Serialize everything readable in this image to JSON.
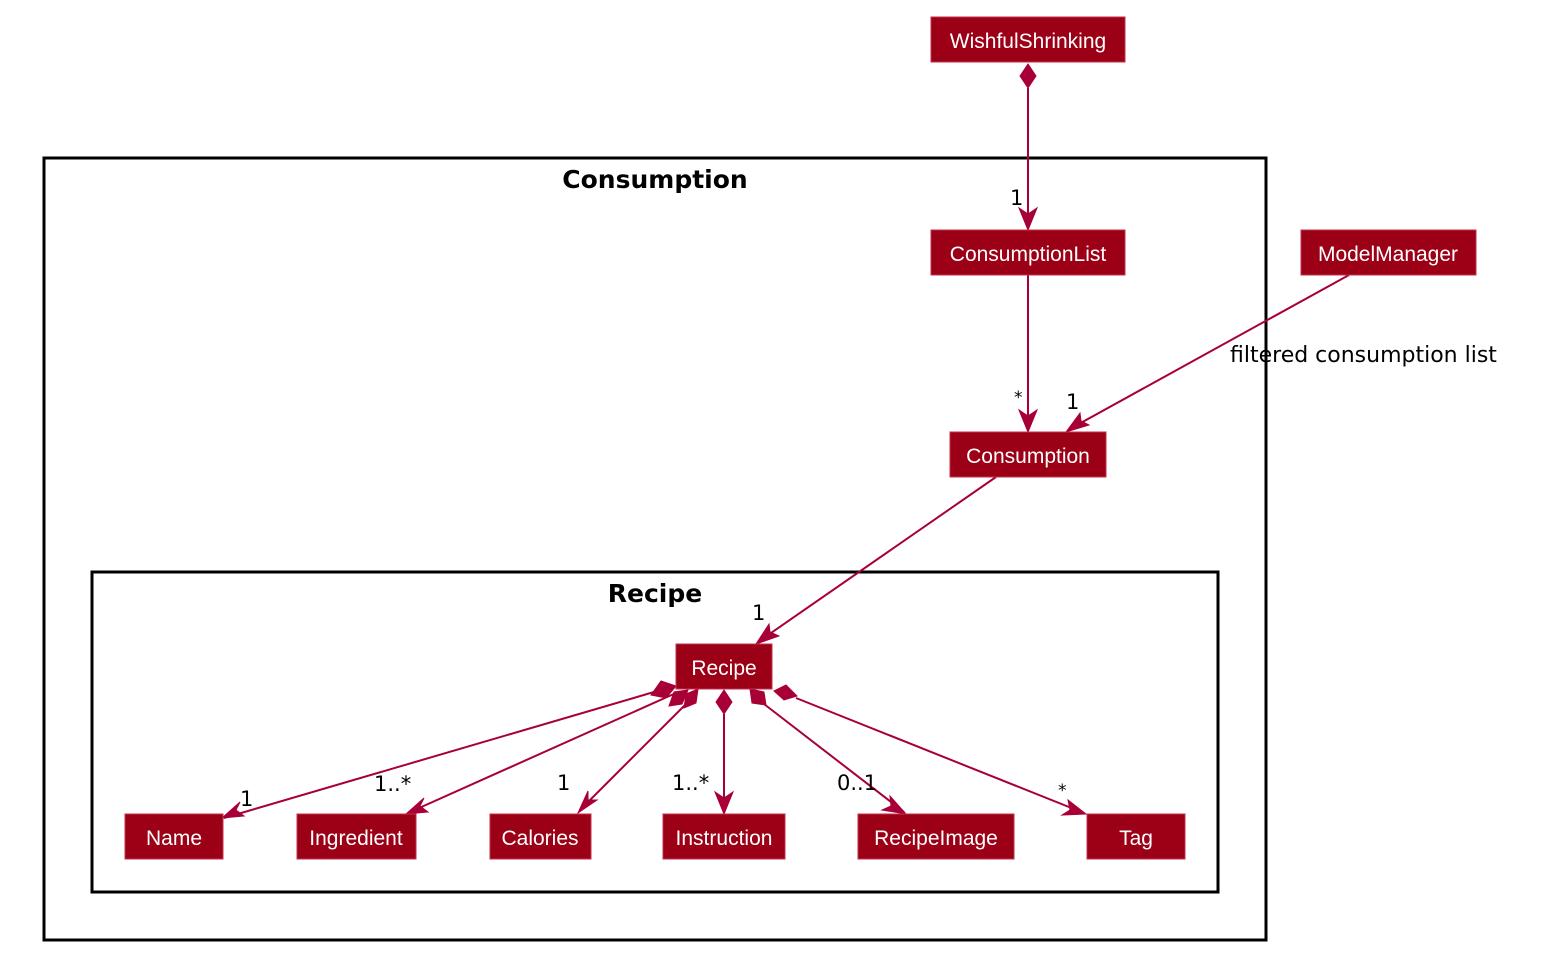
{
  "diagram": {
    "type": "uml-class-diagram",
    "colors": {
      "class_fill": "#9b0016",
      "edge": "#a80036",
      "class_text": "#ffffff",
      "package_border": "#000000"
    },
    "packages": [
      {
        "id": "consumption-pkg",
        "title": "Consumption"
      },
      {
        "id": "recipe-pkg",
        "title": "Recipe"
      }
    ],
    "classes": [
      {
        "id": "WishfulShrinking",
        "label": "WishfulShrinking"
      },
      {
        "id": "ConsumptionList",
        "label": "ConsumptionList"
      },
      {
        "id": "ModelManager",
        "label": "ModelManager"
      },
      {
        "id": "Consumption",
        "label": "Consumption"
      },
      {
        "id": "Recipe",
        "label": "Recipe"
      },
      {
        "id": "Name",
        "label": "Name"
      },
      {
        "id": "Ingredient",
        "label": "Ingredient"
      },
      {
        "id": "Calories",
        "label": "Calories"
      },
      {
        "id": "Instruction",
        "label": "Instruction"
      },
      {
        "id": "RecipeImage",
        "label": "RecipeImage"
      },
      {
        "id": "Tag",
        "label": "Tag"
      }
    ],
    "relations": [
      {
        "id": "ws-cl",
        "from": "WishfulShrinking",
        "to": "ConsumptionList",
        "kind": "composition",
        "multiplicity": "1",
        "label": ""
      },
      {
        "id": "cl-c",
        "from": "ConsumptionList",
        "to": "Consumption",
        "kind": "association",
        "multiplicity": "*",
        "label": ""
      },
      {
        "id": "mm-c",
        "from": "ModelManager",
        "to": "Consumption",
        "kind": "association",
        "multiplicity": "1",
        "label": "filtered consumption list"
      },
      {
        "id": "c-r",
        "from": "Consumption",
        "to": "Recipe",
        "kind": "association",
        "multiplicity": "1",
        "label": ""
      },
      {
        "id": "r-name",
        "from": "Recipe",
        "to": "Name",
        "kind": "composition",
        "multiplicity": "1",
        "label": ""
      },
      {
        "id": "r-ing",
        "from": "Recipe",
        "to": "Ingredient",
        "kind": "composition",
        "multiplicity": "1..*",
        "label": ""
      },
      {
        "id": "r-cal",
        "from": "Recipe",
        "to": "Calories",
        "kind": "composition",
        "multiplicity": "1",
        "label": ""
      },
      {
        "id": "r-ins",
        "from": "Recipe",
        "to": "Instruction",
        "kind": "composition",
        "multiplicity": "1..*",
        "label": ""
      },
      {
        "id": "r-img",
        "from": "Recipe",
        "to": "RecipeImage",
        "kind": "composition",
        "multiplicity": "0..1",
        "label": ""
      },
      {
        "id": "r-tag",
        "from": "Recipe",
        "to": "Tag",
        "kind": "composition",
        "multiplicity": "*",
        "label": ""
      }
    ]
  }
}
